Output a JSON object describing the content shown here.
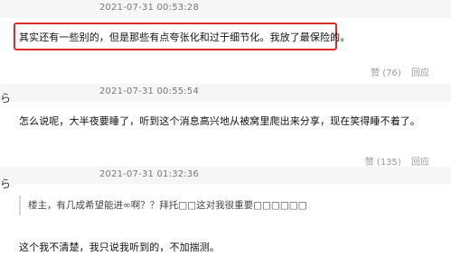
{
  "comments": [
    {
      "timestamp": "2021-07-31 00:53:28",
      "text": "其实还有一些别的，但是那些有点夸张化和过于细节化。我放了最保险的。",
      "like_label": "赞 (76)",
      "reply_label": "回应",
      "avatar_fragment": "",
      "highlight_color": "#e02a2a"
    },
    {
      "timestamp": "2021-07-31 00:55:54",
      "text": "怎么说呢，大半夜要睡了，听到这个消息高兴地从被窝里爬出来分享，现在笑得睡不着了。",
      "like_label": "赞 (135)",
      "reply_label": "回应",
      "avatar_fragment": "ら"
    },
    {
      "timestamp": "2021-07-31 01:32:36",
      "quote": "楼主，有几成希望能进∞啊？？拜托□□这对我很重要□□□□□□",
      "text": "这个我不清楚，我只说我听到的，不加揣测。",
      "avatar_fragment": "ら"
    }
  ],
  "icons": {
    "like": "thumbs-up-icon"
  }
}
